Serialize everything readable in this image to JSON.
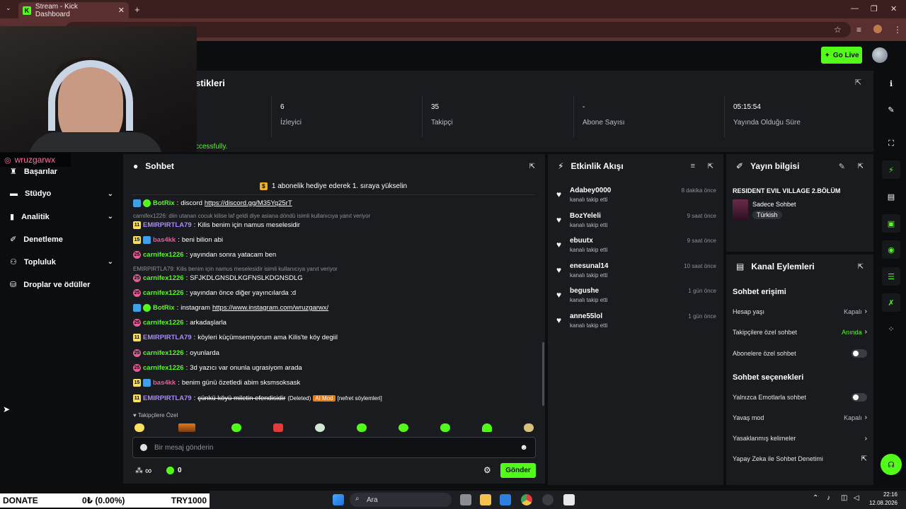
{
  "browser": {
    "tab_title": "Stream - Kick Dashboard",
    "tab_close": "✕",
    "new_tab": "+"
  },
  "header": {
    "go_live_label": "Go Live"
  },
  "stats": {
    "title": "stikleri",
    "cells": [
      {
        "value": "6",
        "label": "İzleyici"
      },
      {
        "value": "35",
        "label": "Takipçi"
      },
      {
        "value": "-",
        "label": "Abone Sayısı"
      },
      {
        "value": "05:15:54",
        "label": "Yayında Olduğu Süre"
      }
    ],
    "success_text": "ccessfully."
  },
  "webcam": {
    "instagram_handle": "wruzgarwx"
  },
  "sidebar": {
    "items": [
      {
        "label": "Başarılar",
        "has_chevron": false
      },
      {
        "label": "Stüdyo",
        "has_chevron": true
      },
      {
        "label": "Analitik",
        "has_chevron": true
      },
      {
        "label": "Denetleme",
        "has_chevron": false
      },
      {
        "label": "Topluluk",
        "has_chevron": true
      },
      {
        "label": "Droplar ve ödüller",
        "has_chevron": false
      }
    ]
  },
  "chat": {
    "title": "Sohbet",
    "pinned": "1 abonelik hediye ederek 1. sıraya yükselin",
    "messages": [
      {
        "user": "BotRix",
        "color": "#53fc18",
        "badges": [
          "blue",
          "green"
        ],
        "text": "discord ",
        "link": "https://discord.gg/M35Yq25rT"
      },
      {
        "reply": "carnifex1226: diin utanan cocuk kilise laf geldi diye asiana döndü isimli kullanıcıya yanıt veriyor"
      },
      {
        "user": "EMIRPIRTLA79",
        "color": "#a78bfa",
        "badges": [
          "yellow"
        ],
        "badge_text": "11",
        "text": "Kilis benim için namus meselesidir"
      },
      {
        "user": "bas4kk",
        "color": "#e95a9b",
        "badges": [
          "yellow",
          "blue"
        ],
        "badge_text": "15",
        "text": "beni bilion abi"
      },
      {
        "user": "carnifex1226",
        "color": "#53fc18",
        "badges": [
          "pink"
        ],
        "badge_text": "25",
        "text": "yayından sonra yatacam ben"
      },
      {
        "reply": "EMIRPIRTLA79: Kilis benim için namus meselesidir isimli kullanıcıya yanıt veriyor"
      },
      {
        "user": "carnifex1226",
        "color": "#53fc18",
        "badges": [
          "pink"
        ],
        "badge_text": "25",
        "text": "SFJKDLGNSDLKGFNSLKDGNSDLG"
      },
      {
        "user": "carnifex1226",
        "color": "#53fc18",
        "badges": [
          "pink"
        ],
        "badge_text": "25",
        "text": "yayından önce diğer yayıncılarda :d"
      },
      {
        "user": "BotRix",
        "color": "#53fc18",
        "badges": [
          "blue",
          "green"
        ],
        "text": "instagram ",
        "link": "https://www.instagram.com/wruzgarwx/"
      },
      {
        "user": "carnifex1226",
        "color": "#53fc18",
        "badges": [
          "pink"
        ],
        "badge_text": "25",
        "text": "arkadaşlarla"
      },
      {
        "user": "EMIRPIRTLA79",
        "color": "#a78bfa",
        "badges": [
          "yellow"
        ],
        "badge_text": "11",
        "text": "köyleri küçümsemiyorum ama Kilis'te köy degiil"
      },
      {
        "user": "carnifex1226",
        "color": "#53fc18",
        "badges": [
          "pink"
        ],
        "badge_text": "25",
        "text": "oyunlarda"
      },
      {
        "user": "carnifex1226",
        "color": "#53fc18",
        "badges": [
          "pink"
        ],
        "badge_text": "25",
        "text": "3d yazıcı var onunla ugrasiyom arada"
      },
      {
        "user": "bas4kk",
        "color": "#e95a9b",
        "badges": [
          "yellow",
          "blue"
        ],
        "badge_text": "15",
        "text": "benim günü özetledi abim sksmsoksask"
      },
      {
        "user": "EMIRPIRTLA79",
        "color": "#a78bfa",
        "badges": [
          "yellow"
        ],
        "badge_text": "11",
        "text": "çünkü köyü miletin efendisidir",
        "deleted": true,
        "deleted_label": "(Deleted)",
        "mod_label": "AI Mod",
        "mod_reason": "[nefret söylemleri]"
      }
    ],
    "followers_only": "Takipçilere Özel",
    "input_placeholder": "Bir mesaj gönderin",
    "viewer_count_label": "∞",
    "points": "0",
    "send_label": "Gönder"
  },
  "activity": {
    "title": "Etkinlik Akışı",
    "items": [
      {
        "name": "Adabey0000",
        "action": "kanalı takip etti",
        "time": "8 dakika önce"
      },
      {
        "name": "BozYeleli",
        "action": "kanalı takip etti",
        "time": "9 saat önce"
      },
      {
        "name": "ebuutx",
        "action": "kanalı takip etti",
        "time": "9 saat önce"
      },
      {
        "name": "enesunal14",
        "action": "kanalı takip etti",
        "time": "10 saat önce"
      },
      {
        "name": "begushe",
        "action": "kanalı takip etti",
        "time": "1 gün önce"
      },
      {
        "name": "anne55lol",
        "action": "kanalı takip etti",
        "time": "1 gün önce"
      }
    ]
  },
  "stream_info": {
    "title": "Yayın bilgisi",
    "stream_title": "RESIDENT EVIL VILLAGE 2.BÖLÜM",
    "category": "Sadece Sohbet",
    "language_tag": "Türkish"
  },
  "channel_actions": {
    "title": "Kanal Eylemleri",
    "access_section": "Sohbet erişimi",
    "access_rows": [
      {
        "label": "Hesap yaşı",
        "value": "Kapalı",
        "type": "arrow"
      },
      {
        "label": "Takipçilere özel sohbet",
        "value": "Anında",
        "type": "arrow",
        "green": true
      },
      {
        "label": "Abonelere özel sohbet",
        "value": "",
        "type": "toggle"
      }
    ],
    "options_section": "Sohbet seçenekleri",
    "option_rows": [
      {
        "label": "Yalnızca Emotlarla sohbet",
        "value": "",
        "type": "toggle"
      },
      {
        "label": "Yavaş mod",
        "value": "Kapalı",
        "type": "arrow"
      },
      {
        "label": "Yasaklanmış kelimeler",
        "value": "",
        "type": "arrow"
      },
      {
        "label": "Yapay Zeka ile Sohbet Denetimi",
        "value": "",
        "type": "external"
      }
    ]
  },
  "donate": {
    "label": "DONATE",
    "amount": "0₺ (0.00%)",
    "goal": "TRY1000"
  },
  "taskbar": {
    "search_label": "Ara",
    "time": "22:16",
    "date": "12.08.2026"
  }
}
